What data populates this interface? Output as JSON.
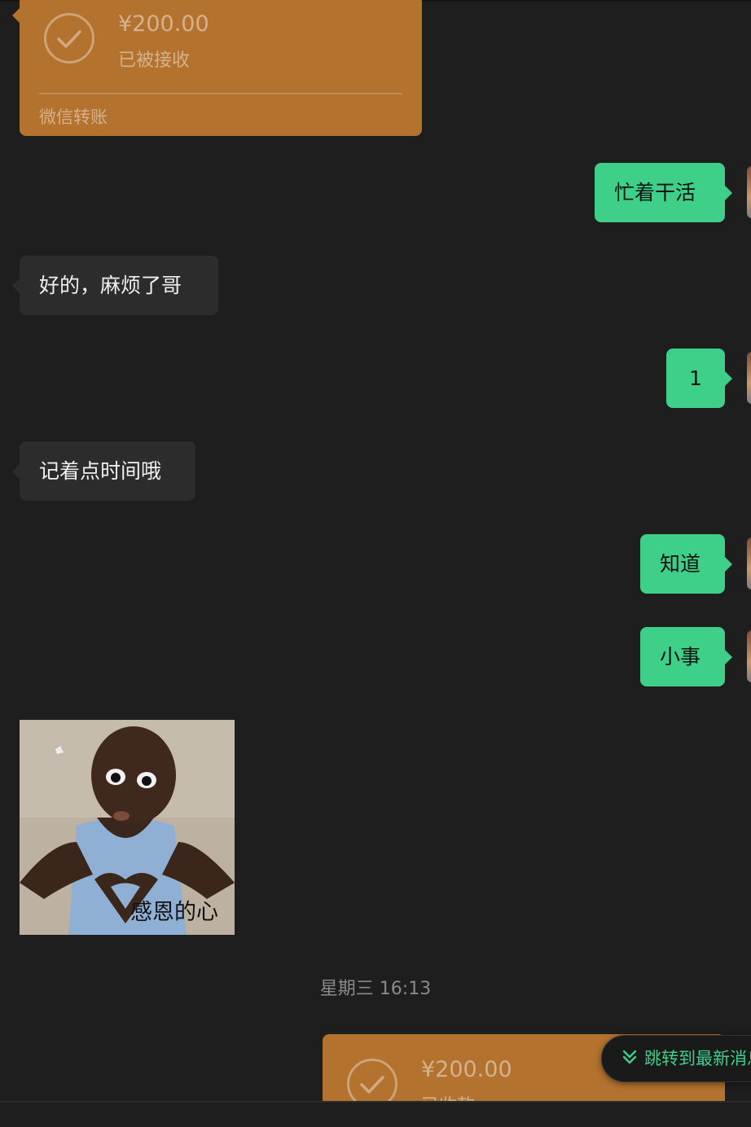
{
  "messages": {
    "transfer_top": {
      "amount": "¥200.00",
      "status": "已被接收",
      "footer": "微信转账"
    },
    "m1": "忙着干活",
    "m2": "好的，麻烦了哥",
    "m3": "1",
    "m4": "记着点时间哦",
    "m5": "知道",
    "m6": "小事",
    "sticker": {
      "caption": "感恩的心"
    },
    "timestamp": "星期三 16:13",
    "transfer_bottom": {
      "amount": "¥200.00",
      "status": "已收款"
    }
  },
  "jump_button": {
    "label": "跳转到最新消息"
  },
  "colors": {
    "outgoing_bubble": "#3ecf89",
    "incoming_bubble": "#2c2c2c",
    "transfer_card": "#b3722e",
    "background": "#1e1e1e"
  }
}
